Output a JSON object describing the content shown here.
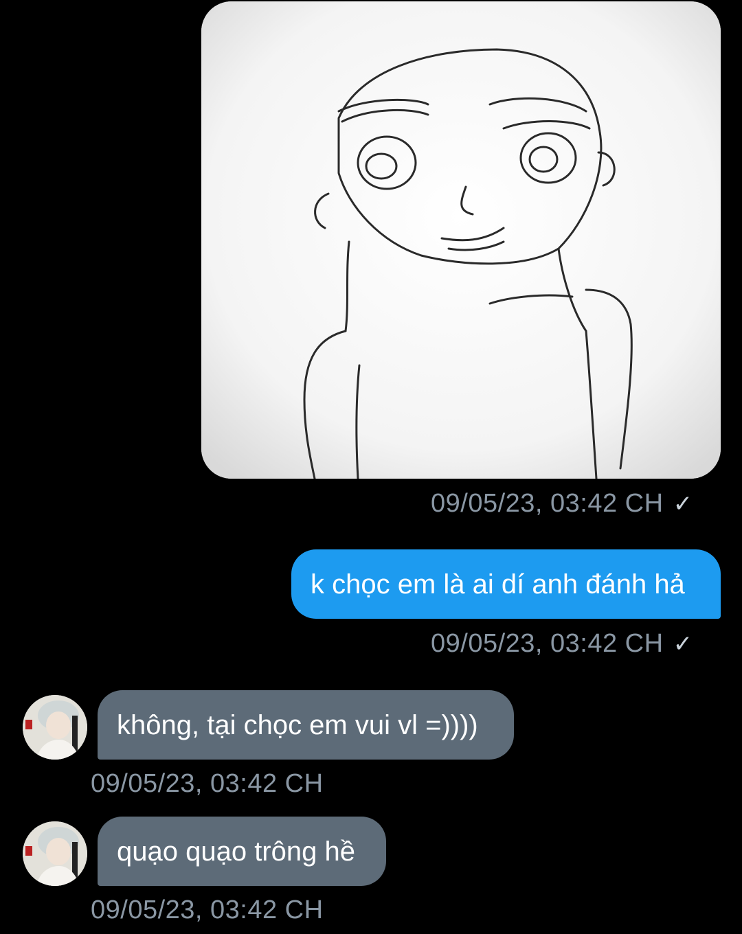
{
  "messages": [
    {
      "type": "image",
      "direction": "outgoing",
      "alt_icon": "sketch-drawing",
      "timestamp": "09/05/23, 03:42 CH",
      "status": "✓"
    },
    {
      "type": "text",
      "direction": "outgoing",
      "text": "k chọc em là ai dí anh đánh hả",
      "timestamp": "09/05/23, 03:42 CH",
      "status": "✓"
    },
    {
      "type": "text",
      "direction": "incoming",
      "text": "không, tại chọc em vui vl =))))",
      "timestamp": "09/05/23, 03:42 CH"
    },
    {
      "type": "text",
      "direction": "incoming",
      "text": "quạo quạo trông hề",
      "timestamp": "09/05/23, 03:42 CH"
    }
  ],
  "colors": {
    "background": "#000000",
    "outgoing_bubble": "#1d9bf0",
    "incoming_bubble": "#5d6b78",
    "timestamp": "#8a97a4"
  }
}
